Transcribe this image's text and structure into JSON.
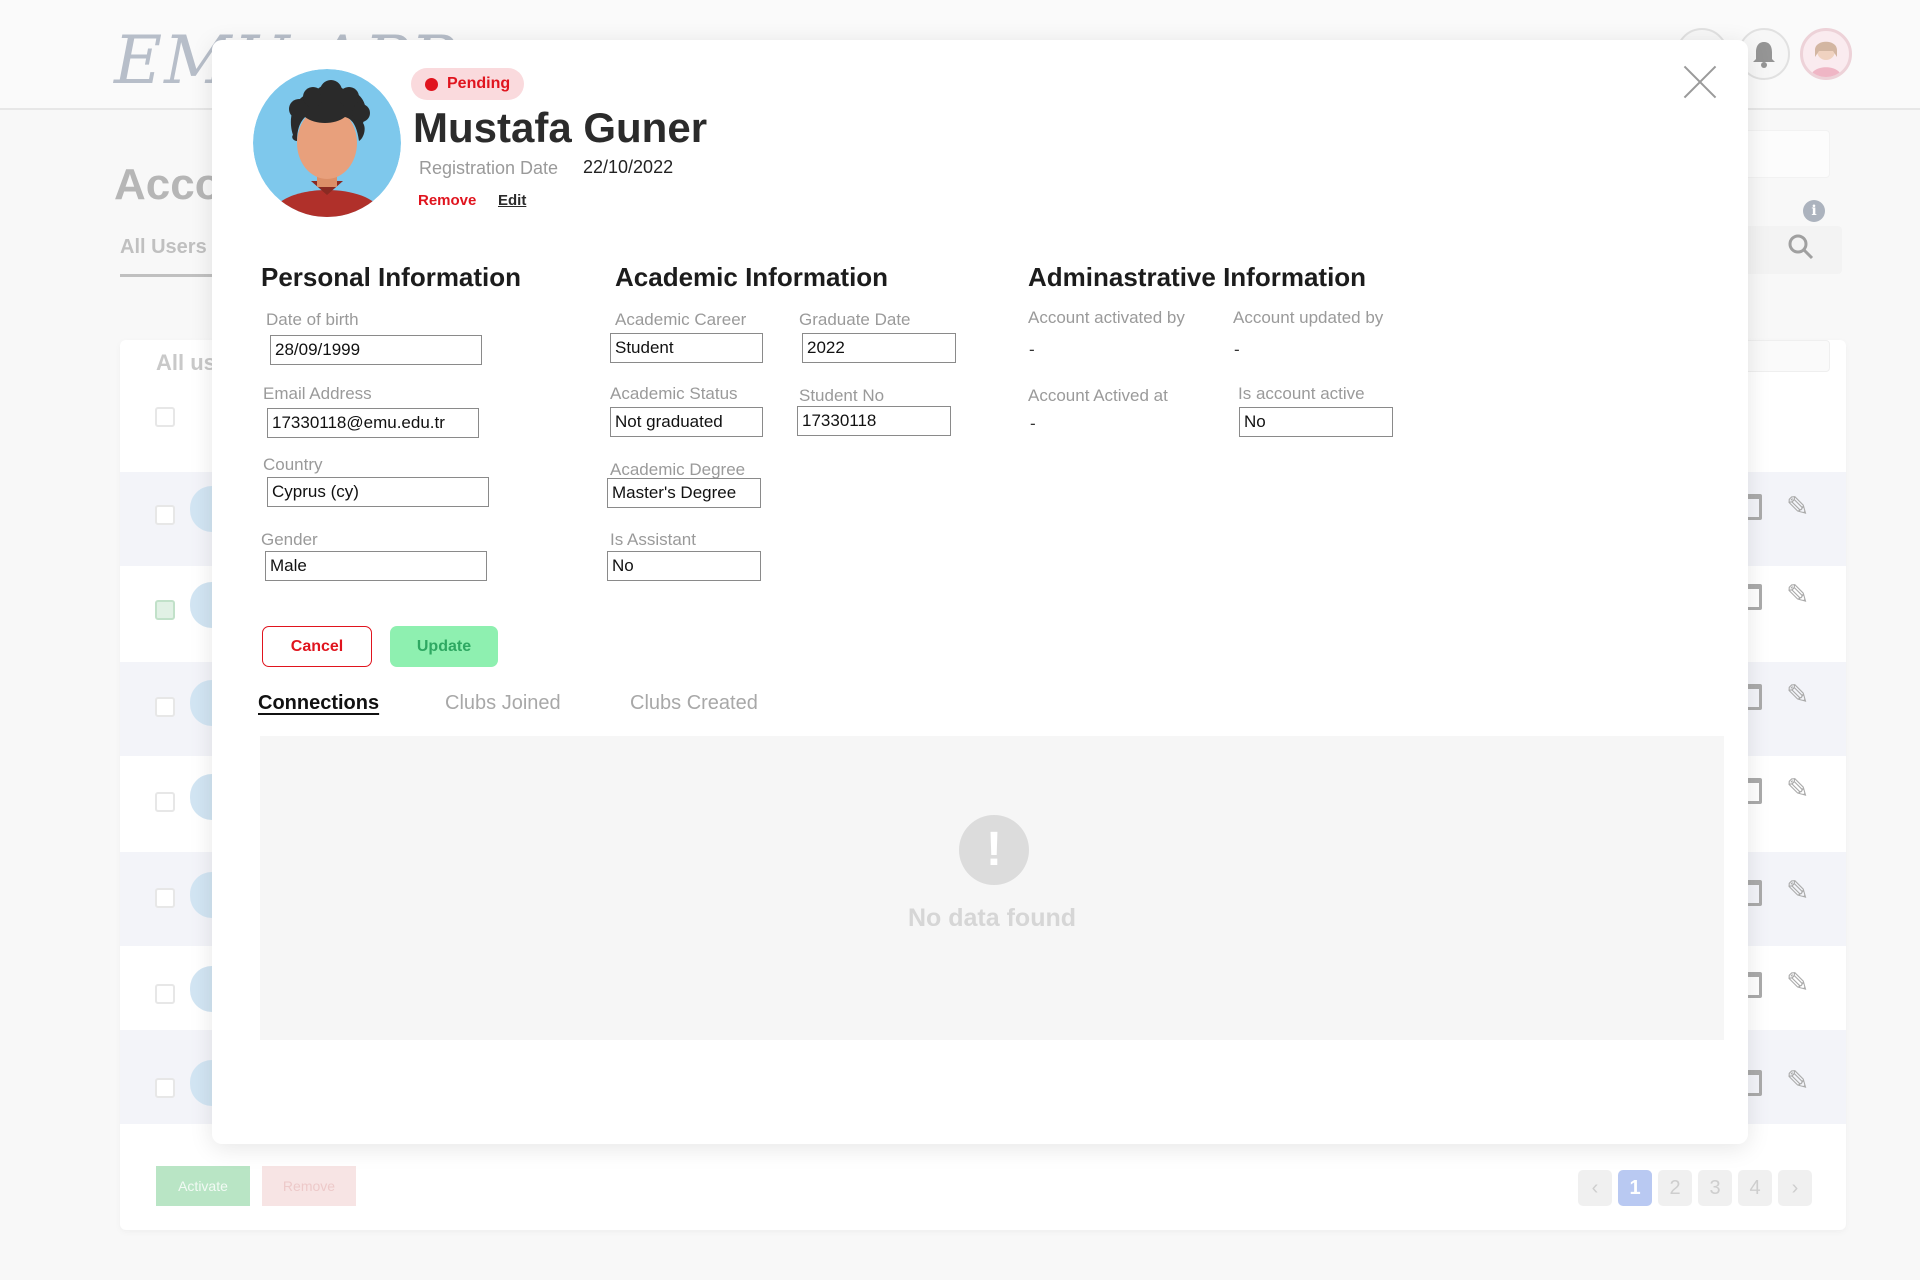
{
  "background": {
    "logo": "EMU APP",
    "page_title": "Accounts",
    "tab_all_users": "All Users",
    "card_title": "All users",
    "bulk_activate_label": "Activate",
    "bulk_remove_label": "Remove",
    "pagination": {
      "prev": "‹",
      "next": "›",
      "pages": [
        "1",
        "2",
        "3",
        "4"
      ],
      "current": "1"
    }
  },
  "profile": {
    "status": "Pending",
    "status_color": "#e0141e",
    "name": "Mustafa Guner",
    "registration_date_label": "Registration Date",
    "registration_date": "22/10/2022",
    "remove_label": "Remove",
    "edit_label": "Edit"
  },
  "personal": {
    "title": "Personal Information",
    "dob_label": "Date of birth",
    "dob": "28/09/1999",
    "email_label": "Email Address",
    "email": "17330118@emu.edu.tr",
    "country_label": "Country",
    "country": "Cyprus (cy)",
    "gender_label": "Gender",
    "gender": "Male"
  },
  "academic": {
    "title": "Academic Information",
    "career_label": "Academic Career",
    "career": "Student",
    "graduate_date_label": "Graduate Date",
    "graduate_date": "2022",
    "status_label": "Academic Status",
    "status": "Not graduated",
    "student_no_label": "Student No",
    "student_no": "17330118",
    "degree_label": "Academic Degree",
    "degree": "Master's Degree",
    "assistant_label": "Is Assistant",
    "assistant": "No"
  },
  "administrative": {
    "title": "Adminastrative Information",
    "activated_by_label": "Account activated by",
    "activated_by": "-",
    "updated_by_label": "Account updated by",
    "updated_by": "-",
    "activated_at_label": "Account Actived at",
    "activated_at": "-",
    "is_active_label": "Is account active",
    "is_active": "No"
  },
  "actions": {
    "cancel_label": "Cancel",
    "update_label": "Update"
  },
  "tabs": [
    {
      "label": "Connections",
      "active": true
    },
    {
      "label": "Clubs Joined",
      "active": false
    },
    {
      "label": "Clubs Created",
      "active": false
    }
  ],
  "empty_state": {
    "icon": "!",
    "message": "No data found"
  },
  "icons": {
    "close": "close-icon",
    "empty": "exclamation-icon",
    "bell": "bell-icon",
    "search": "search-icon",
    "info": "info-icon",
    "trash": "trash-icon",
    "pencil": "pencil-icon"
  }
}
